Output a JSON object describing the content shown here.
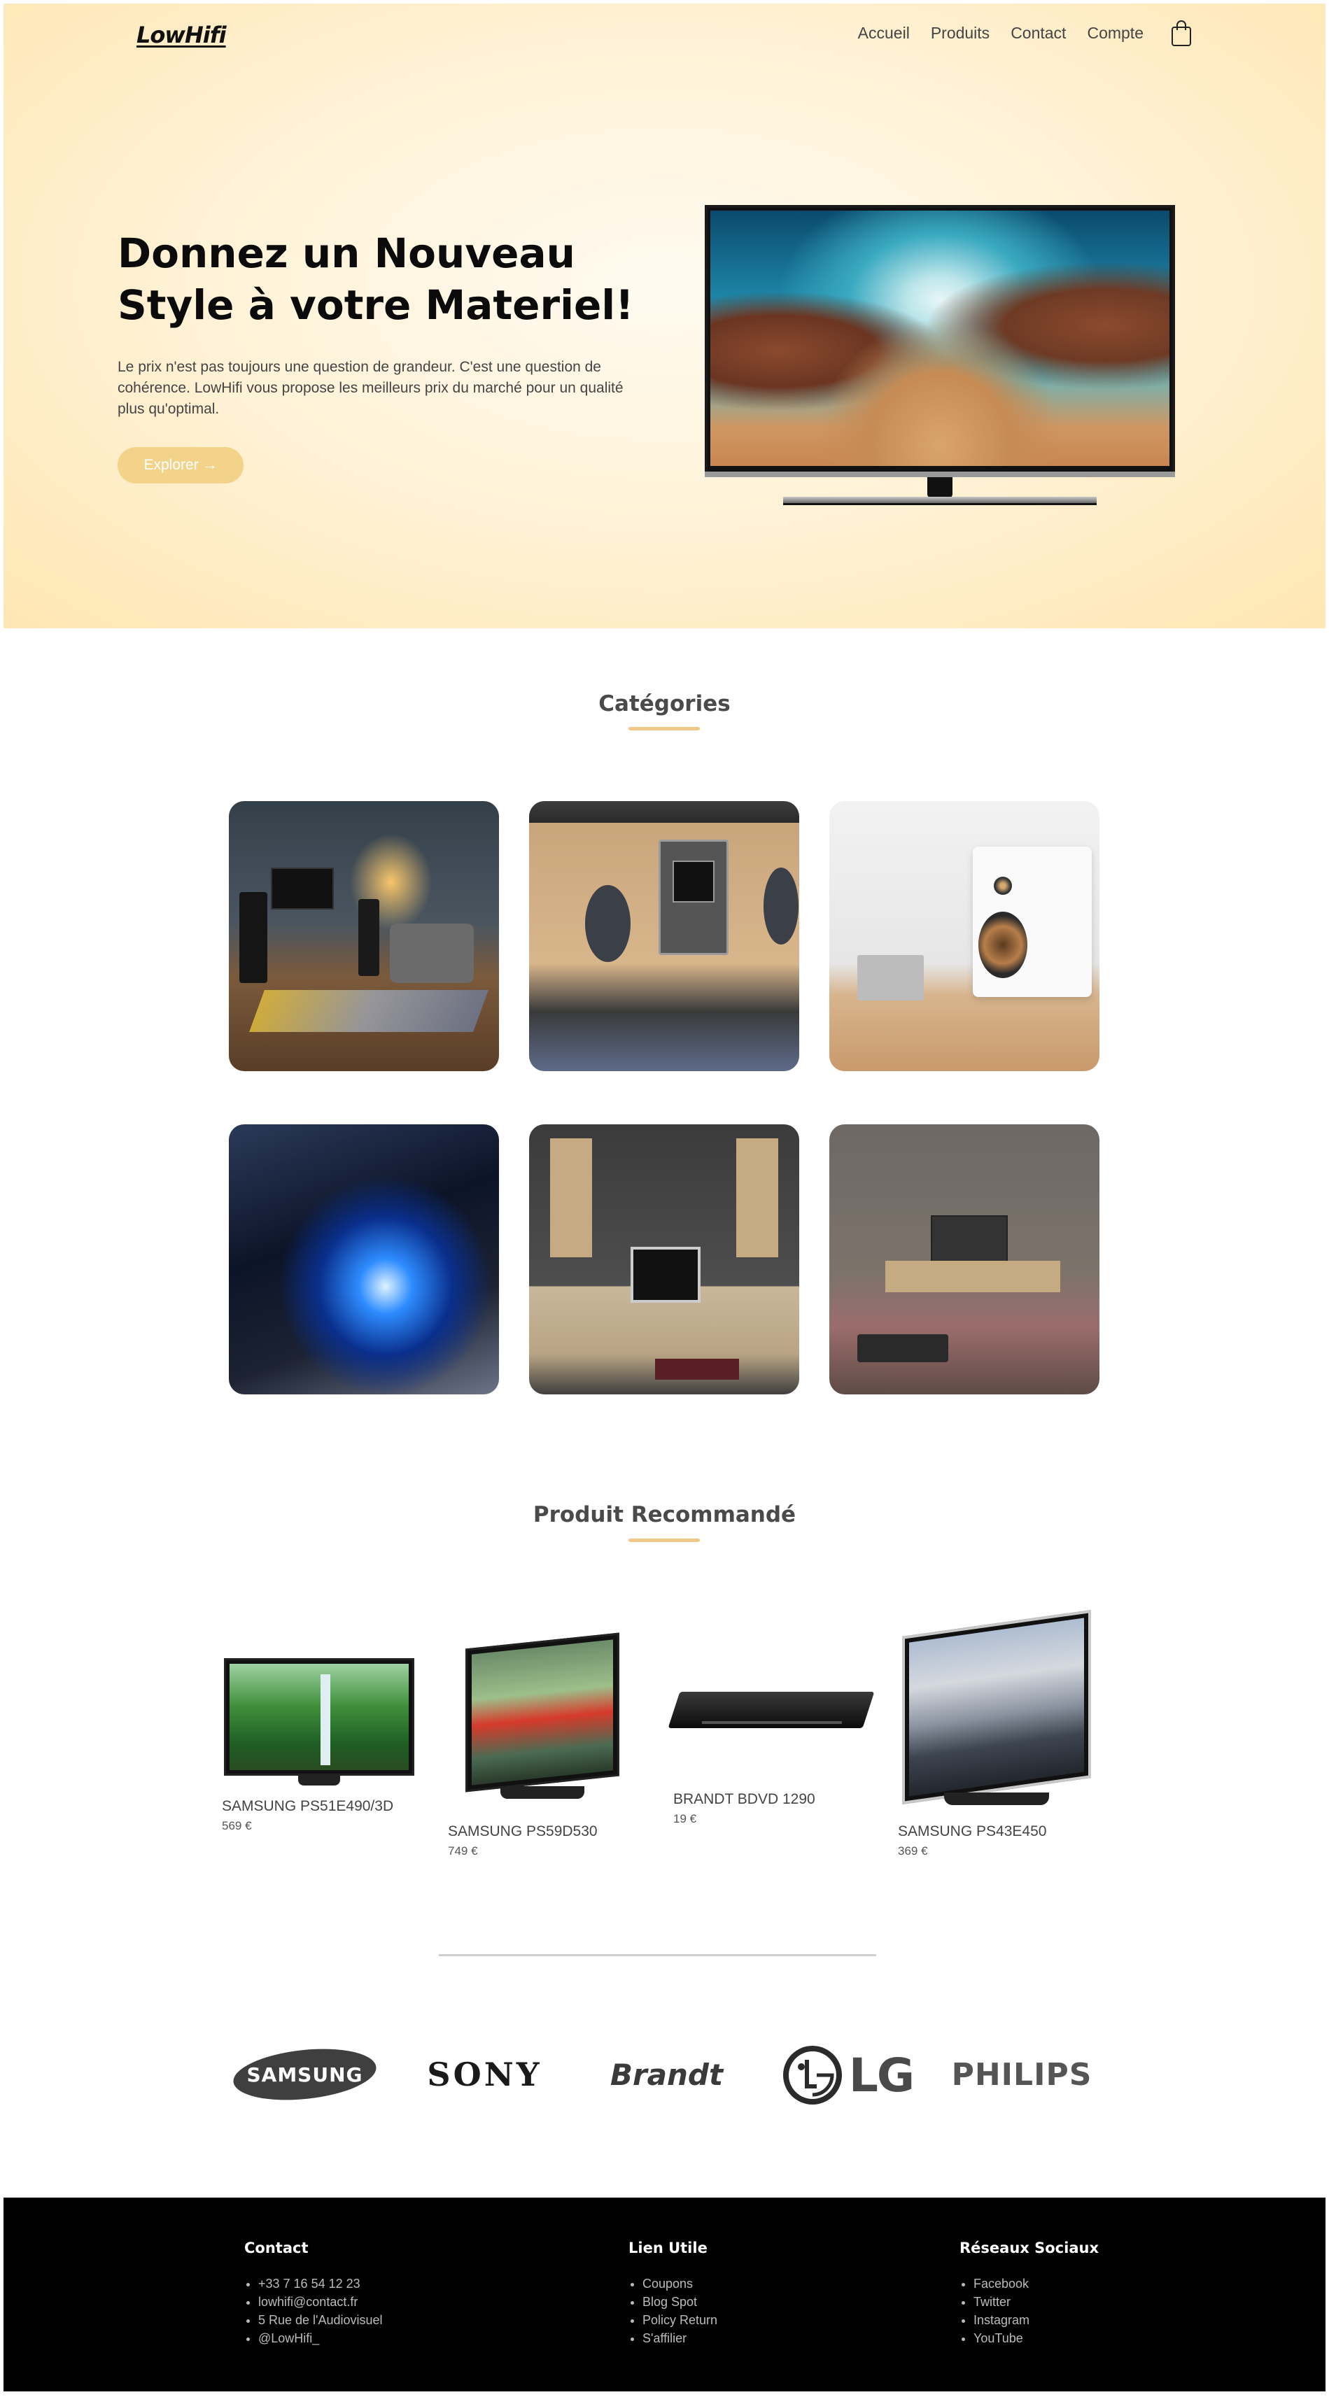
{
  "header": {
    "logo": "LowHifi",
    "nav": [
      "Accueil",
      "Produits",
      "Contact",
      "Compte"
    ],
    "cart_icon": "shopping-bag-icon"
  },
  "hero": {
    "title": "Donnez un Nouveau Style à votre Materiel!",
    "text": "Le prix n'est pas toujours une question de grandeur. C'est une question de cohérence. LowHifi vous propose les meilleurs prix du marché pour un qualité plus qu'optimal.",
    "button": "Explorer →"
  },
  "categories": {
    "title": "Catégories"
  },
  "recommended": {
    "title": "Produit Recommandé",
    "products": [
      {
        "name": "SAMSUNG PS51E490/3D",
        "price": "569 €"
      },
      {
        "name": "SAMSUNG PS59D530",
        "price": "749 €"
      },
      {
        "name": "BRANDT BDVD 1290",
        "price": "19 €"
      },
      {
        "name": "SAMSUNG PS43E450",
        "price": "369 €"
      }
    ]
  },
  "brands": [
    "SAMSUNG",
    "SONY",
    "Brandt",
    "LG",
    "PHILIPS"
  ],
  "footer": {
    "contact": {
      "title": "Contact",
      "items": [
        "+33 7 16 54 12 23",
        "lowhifi@contact.fr",
        "5 Rue de l'Audiovisuel",
        "@LowHifi_"
      ]
    },
    "links": {
      "title": "Lien Utile",
      "items": [
        "Coupons",
        "Blog Spot",
        "Policy Return",
        "S'affilier"
      ]
    },
    "social": {
      "title": "Réseaux Sociaux",
      "items": [
        "Facebook",
        "Twitter",
        "Instagram",
        "YouTube"
      ]
    }
  },
  "colors": {
    "accent": "#f3d38a",
    "hero_bg": "#fff3d9",
    "footer_bg": "#000000"
  }
}
